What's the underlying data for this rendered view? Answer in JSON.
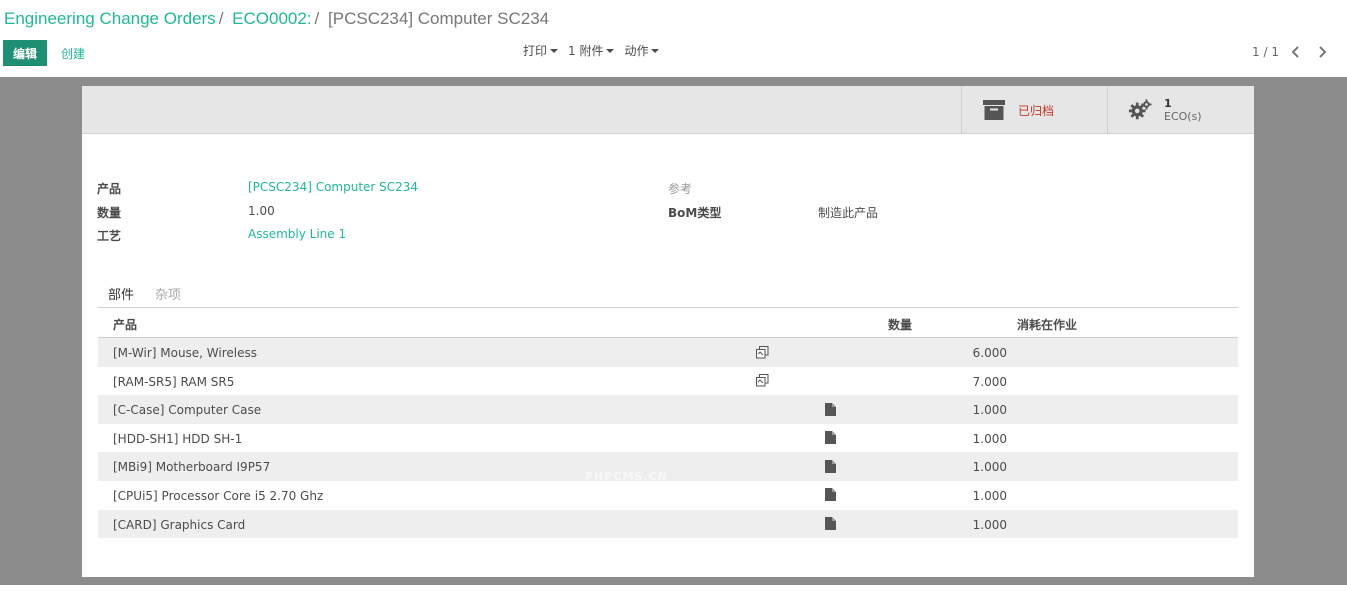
{
  "breadcrumb": {
    "items": [
      "Engineering Change Orders",
      "ECO0002:",
      "[PCSC234] Computer SC234"
    ],
    "separator": "/"
  },
  "toolbar": {
    "edit_label": "编辑",
    "create_label": "创建",
    "print_label": "打印",
    "attachments_label": "1 附件",
    "action_label": "动作"
  },
  "pager": {
    "value": "1 / 1"
  },
  "smart_buttons": {
    "archive_label": "已归档",
    "eco_count": "1",
    "eco_unit": "ECO(s)"
  },
  "form": {
    "product_label": "产品",
    "product_value": "[PCSC234] Computer SC234",
    "quantity_label": "数量",
    "quantity_value": "1.00",
    "routing_label": "工艺",
    "routing_value": "Assembly Line 1",
    "reference_label": "参考",
    "bom_type_label": "BoM类型",
    "bom_type_value": "制造此产品"
  },
  "tabs": {
    "components": "部件",
    "misc": "杂项"
  },
  "table": {
    "headers": {
      "product": "产品",
      "quantity": "数量",
      "consumed_in": "消耗在作业"
    },
    "rows": [
      {
        "product": "[M-Wir] Mouse, Wireless",
        "icon": "copy-icon",
        "quantity": "6.000"
      },
      {
        "product": "[RAM-SR5] RAM SR5",
        "icon": "copy-icon",
        "quantity": "7.000"
      },
      {
        "product": "[C-Case] Computer Case",
        "icon": "file-icon",
        "quantity": "1.000"
      },
      {
        "product": "[HDD-SH1] HDD SH-1",
        "icon": "file-icon",
        "quantity": "1.000"
      },
      {
        "product": "[MBi9] Motherboard I9P57",
        "icon": "file-icon",
        "quantity": "1.000"
      },
      {
        "product": "[CPUi5] Processor Core i5 2.70 Ghz",
        "icon": "file-icon",
        "quantity": "1.000"
      },
      {
        "product": "[CARD] Graphics Card",
        "icon": "file-icon",
        "quantity": "1.000"
      }
    ]
  },
  "watermark": "PHPCMS.CN",
  "colors": {
    "brand_link": "#21b799",
    "edit_button": "#1f8f73",
    "archive_text": "#c0392b",
    "backdrop": "#8c8c8c"
  }
}
